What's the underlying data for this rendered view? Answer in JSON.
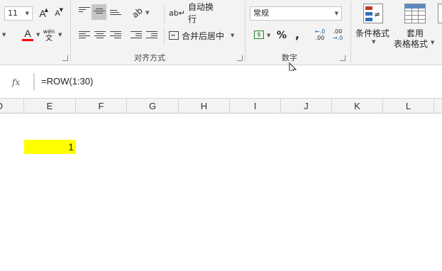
{
  "ribbon": {
    "font": {
      "size": "11",
      "grow_icon": "A",
      "shrink_icon": "A",
      "phonetic_top": "wén",
      "phonetic_bottom": "文",
      "font_color_icon": "A",
      "font_color": "#ff0000"
    },
    "alignment": {
      "wrap_text_label": "自动换行",
      "merge_center_label": "合并后居中",
      "group_label": "对齐方式"
    },
    "number": {
      "format_value": "常规",
      "percent": "%",
      "comma": ",",
      "group_label": "数字"
    },
    "styles": {
      "conditional_format_label": "条件格式",
      "table_format_line1": "套用",
      "table_format_line2": "表格格式"
    }
  },
  "formula_bar": {
    "fx_label": "fx",
    "formula": "=ROW(1:30)"
  },
  "columns": [
    "D",
    "E",
    "F",
    "G",
    "H",
    "I",
    "J",
    "K",
    "L"
  ],
  "cells": [
    {
      "ref": "E2",
      "value": "1",
      "fill": "#ffff00"
    }
  ]
}
